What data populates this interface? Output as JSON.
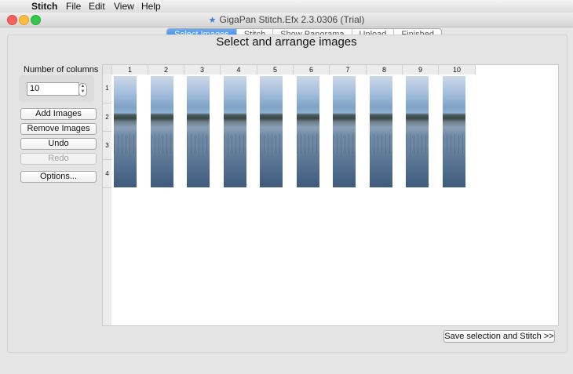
{
  "menubar": {
    "apple_glyph": "",
    "items": [
      "Stitch",
      "File",
      "Edit",
      "View",
      "Help"
    ]
  },
  "window": {
    "title": "GigaPan Stitch.Efx 2.3.0306 (Trial)",
    "icon": "pin-icon"
  },
  "tabs": [
    {
      "label": "Select Images",
      "active": true
    },
    {
      "label": "Stitch",
      "active": false
    },
    {
      "label": "Show Panorama",
      "active": false
    },
    {
      "label": "Upload",
      "active": false
    },
    {
      "label": "Finished",
      "active": false
    }
  ],
  "heading": "Select and arrange images",
  "controls": {
    "columns_label": "Number of columns",
    "columns_value": "10",
    "add_images": "Add Images",
    "remove_images": "Remove Images",
    "undo": "Undo",
    "redo": "Redo",
    "options": "Options..."
  },
  "grid": {
    "column_headers": [
      "1",
      "2",
      "3",
      "4",
      "5",
      "6",
      "7",
      "8",
      "9",
      "10"
    ],
    "row_headers": [
      "1",
      "2",
      "3",
      "4"
    ]
  },
  "save_button": "Save selection and Stitch >>",
  "colors": {
    "accent": "#2f7de6",
    "window_bg": "#e6e6e6"
  }
}
